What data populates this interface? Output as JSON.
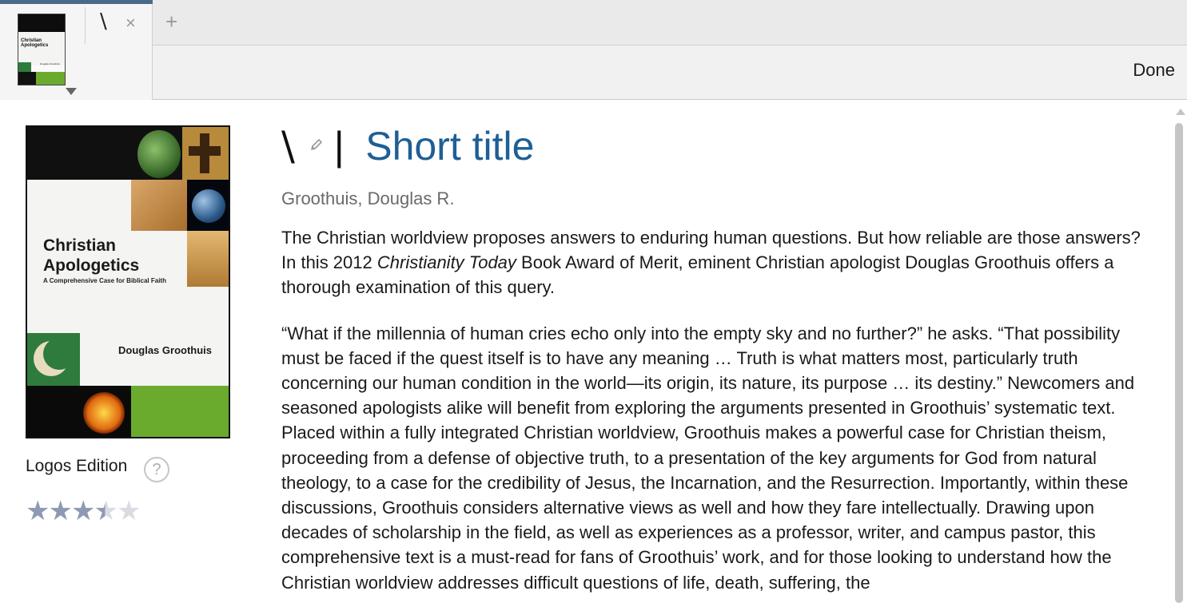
{
  "tabs": [
    {
      "label": "\\",
      "active": true
    }
  ],
  "toolbar": {
    "done_label": "Done"
  },
  "book": {
    "title": "\\",
    "title_separator": "|",
    "short_title_label": "Short title",
    "author": "Groothuis, Douglas R.",
    "edition": "Logos Edition",
    "help_glyph": "?",
    "rating": 3.5,
    "rating_max": 5,
    "cover": {
      "title_line1": "Christian",
      "title_line2": "Apologetics",
      "subtitle": "A Comprehensive Case for Biblical Faith",
      "author": "Douglas Groothuis"
    },
    "description": {
      "p1_a": "The Christian worldview proposes answers to enduring human questions. But how reliable are those answers? In this 2012 ",
      "p1_em": "Christianity Today",
      "p1_b": " Book Award of Merit, eminent Christian apologist Douglas Groothuis offers a thorough examination of this query.",
      "p2": "“What if the millennia of human cries echo only into the empty sky and no further?” he asks. “That possibility must be faced if the quest itself is to have any meaning … Truth is what matters most, particularly truth concerning our human condition in the world—its origin, its nature, its purpose … its destiny.” Newcomers and seasoned apologists alike will benefit from exploring the arguments presented in Groothuis’ systematic text. Placed within a fully integrated Christian worldview, Groothuis makes a powerful case for Christian theism, proceeding from a defense of objective truth, to a presentation of the key arguments for God from natural theology, to a case for the credibility of Jesus, the Incarnation, and the Resurrection. Importantly, within these discussions, Groothuis considers alternative views as well and how they fare intellectually. Drawing upon decades of scholarship in the field, as well as experiences as a professor, writer, and campus pastor, this comprehensive text is a must-read for fans of Groothuis’ work, and for those looking to understand how the Christian worldview addresses difficult questions of life, death, suffering, the"
    }
  },
  "icons": {
    "close": "×",
    "new_tab": "+",
    "star": "★"
  },
  "colors": {
    "accent_tab": "#4a6a8c",
    "short_title": "#1e5f95",
    "star_filled": "#8e9ab3",
    "star_empty": "#d9dce3"
  }
}
